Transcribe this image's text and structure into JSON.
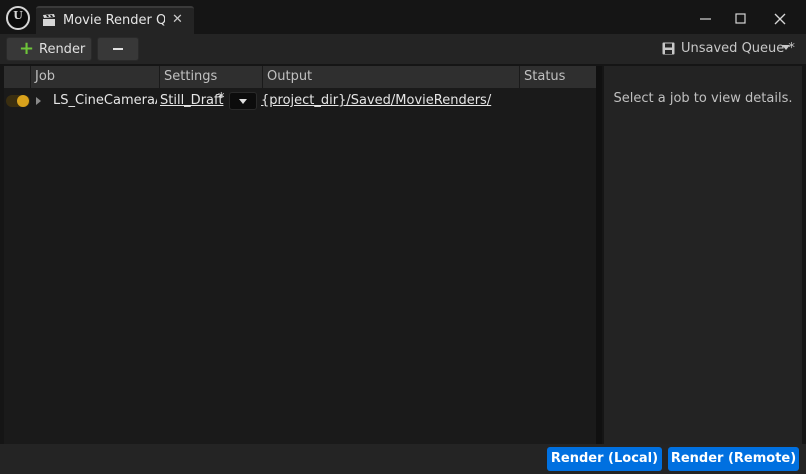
{
  "window": {
    "tab_title": "Movie Render Q...",
    "tab_icon": "clapperboard-icon",
    "controls": [
      "minimize-icon",
      "maximize-icon",
      "close-icon"
    ]
  },
  "toolbar": {
    "render_label": "Render",
    "queue_name": "Unsaved Queue *"
  },
  "job_list": {
    "columns": [
      "Job",
      "Settings",
      "Output",
      "Status"
    ],
    "rows": [
      {
        "enabled": true,
        "job": "LS_CineCameraActor",
        "settings": "Still_Draft",
        "settings_dirty": "*",
        "output": "{project_dir}/Saved/MovieRenders/",
        "status": ""
      }
    ]
  },
  "details": {
    "empty_message": "Select a job to view details."
  },
  "footer": {
    "render_local": "Render (Local)",
    "render_remote": "Render (Remote)"
  },
  "colors": {
    "accent": "#0070e0",
    "toggle_on": "#d9a21c",
    "add_plus": "#6ec43a"
  }
}
